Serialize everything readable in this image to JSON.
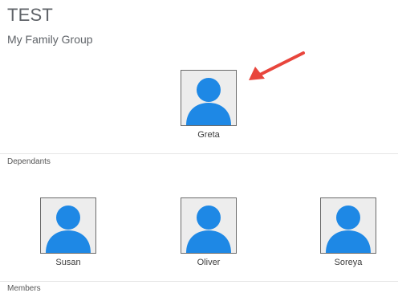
{
  "header": {
    "title": "TEST",
    "subtitle": "My Family Group"
  },
  "owner": {
    "name": "Greta",
    "icon": "person-avatar-icon"
  },
  "sections": {
    "dependants_label": "Dependants",
    "members_label": "Members"
  },
  "dependants": [
    {
      "name": "Susan",
      "icon": "person-avatar-icon"
    },
    {
      "name": "Oliver",
      "icon": "person-avatar-icon"
    },
    {
      "name": "Soreya",
      "icon": "person-avatar-icon"
    }
  ],
  "annotation": {
    "icon": "red-arrow-icon",
    "color": "#e8453c"
  },
  "colors": {
    "avatar_blue": "#1e88e5",
    "avatar_bg": "#ededed"
  }
}
